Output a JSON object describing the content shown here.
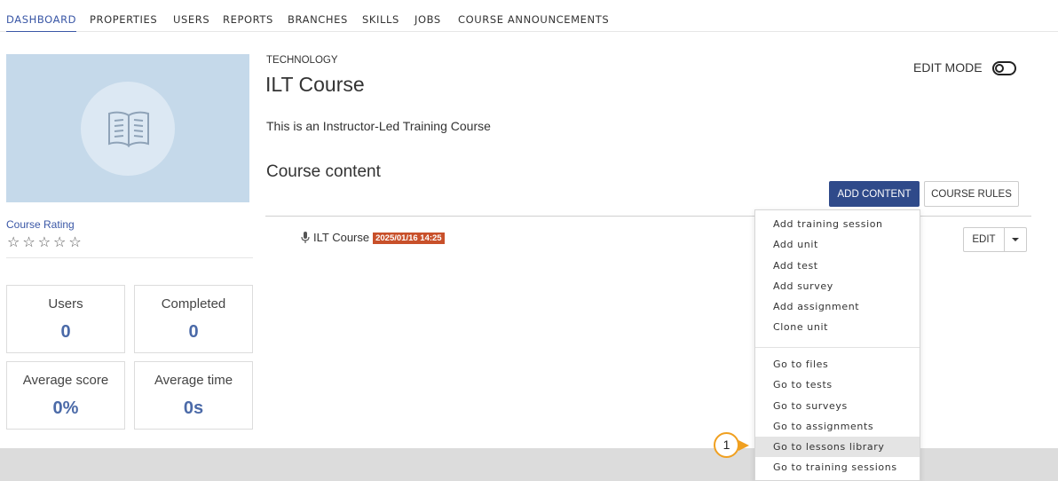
{
  "nav": {
    "tabs": [
      {
        "label": "DASHBOARD",
        "active": true
      },
      {
        "label": "PROPERTIES"
      },
      {
        "label": "USERS"
      },
      {
        "label": "REPORTS"
      },
      {
        "label": "BRANCHES"
      },
      {
        "label": "SKILLS"
      },
      {
        "label": "JOBS"
      },
      {
        "label": "COURSE ANNOUNCEMENTS"
      }
    ]
  },
  "course": {
    "category": "TECHNOLOGY",
    "title": "ILT Course",
    "description": "This is an Instructor-Led Training Course",
    "thumbnail_icon": "book-icon"
  },
  "rating": {
    "label": "Course Rating",
    "stars": [
      "☆",
      "☆",
      "☆",
      "☆",
      "☆"
    ]
  },
  "stats": [
    {
      "label": "Users",
      "value": "0"
    },
    {
      "label": "Completed",
      "value": "0"
    },
    {
      "label": "Average score",
      "value": "0%"
    },
    {
      "label": "Average time",
      "value": "0s"
    }
  ],
  "header": {
    "edit_mode_label": "EDIT MODE",
    "edit_mode_on": false
  },
  "content": {
    "section_title": "Course content",
    "add_content_label": "ADD CONTENT",
    "course_rules_label": "COURSE RULES",
    "units": [
      {
        "icon": "microphone-icon",
        "name": "ILT Course",
        "date": "2025/01/16 14:25",
        "edit_label": "EDIT"
      }
    ]
  },
  "dropdown": {
    "group1": [
      "Add training session",
      "Add unit",
      "Add test",
      "Add survey",
      "Add assignment",
      "Clone unit"
    ],
    "group2": [
      "Go to files",
      "Go to tests",
      "Go to surveys",
      "Go to assignments",
      "Go to lessons library",
      "Go to training sessions"
    ],
    "hovered": "Go to lessons library"
  },
  "marker": {
    "label": "1"
  },
  "colors": {
    "accent": "#3a57a6",
    "primary_button": "#2f4a8a",
    "date_badge": "#c8502a",
    "stat_value": "#4b6aa8",
    "marker": "#f0a020"
  }
}
